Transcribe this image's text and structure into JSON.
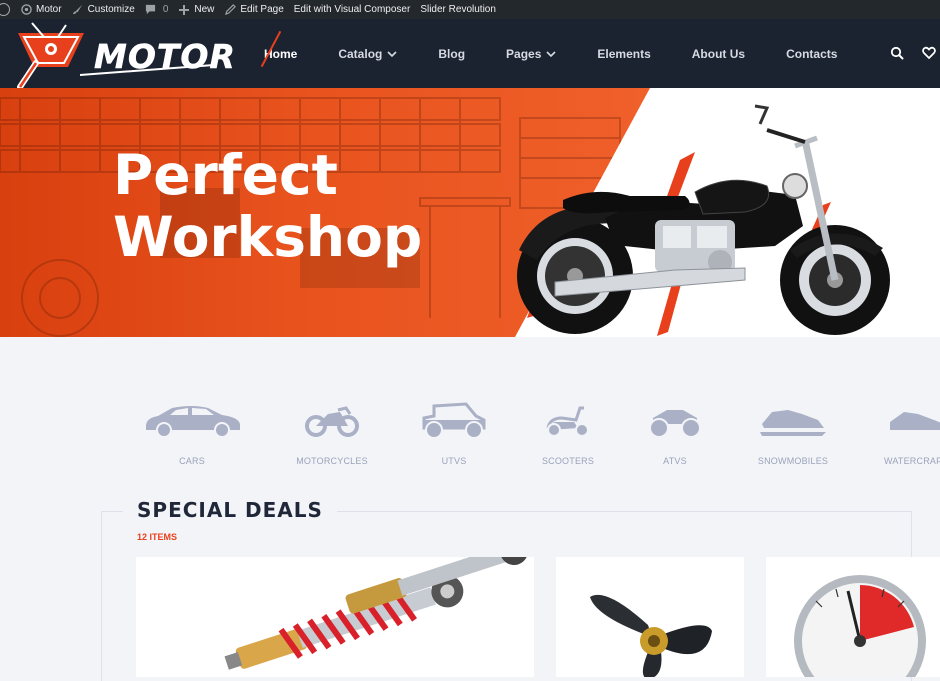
{
  "adminbar": {
    "items": [
      {
        "icon": "wordpress-icon",
        "label": ""
      },
      {
        "icon": "home-icon",
        "label": "Motor"
      },
      {
        "icon": "brush-icon",
        "label": "Customize"
      },
      {
        "icon": "comment-icon",
        "label": "",
        "count": "0"
      },
      {
        "icon": "plus-icon",
        "label": "New"
      },
      {
        "icon": "pencil-icon",
        "label": "Edit Page"
      },
      {
        "icon": "",
        "label": "Edit with Visual Composer"
      },
      {
        "icon": "",
        "label": "Slider Revolution"
      }
    ]
  },
  "header": {
    "logo_text": "MOTOR",
    "nav": [
      {
        "label": "Home",
        "active": true,
        "dropdown": false
      },
      {
        "label": "Catalog",
        "active": false,
        "dropdown": true
      },
      {
        "label": "Blog",
        "active": false,
        "dropdown": false
      },
      {
        "label": "Pages",
        "active": false,
        "dropdown": true
      },
      {
        "label": "Elements",
        "active": false,
        "dropdown": false
      },
      {
        "label": "About Us",
        "active": false,
        "dropdown": false
      },
      {
        "label": "Contacts",
        "active": false,
        "dropdown": false
      }
    ],
    "icons": [
      "search-icon",
      "heart-icon"
    ]
  },
  "hero": {
    "line1": "Perfect",
    "line2": "Workshop"
  },
  "categories": [
    {
      "label": "CARS",
      "icon": "car-icon"
    },
    {
      "label": "MOTORCYCLES",
      "icon": "motorcycle-icon"
    },
    {
      "label": "UTVS",
      "icon": "utv-icon"
    },
    {
      "label": "SCOOTERS",
      "icon": "scooter-icon"
    },
    {
      "label": "ATVS",
      "icon": "atv-icon"
    },
    {
      "label": "SNOWMOBILES",
      "icon": "snowmobile-icon"
    },
    {
      "label": "WATERCRAFT",
      "icon": "watercraft-icon"
    }
  ],
  "deals": {
    "title": "SPECIAL DEALS",
    "count": "12 ITEMS"
  },
  "colors": {
    "accent": "#e8401c",
    "header_bg": "#1b2330",
    "page_bg": "#f3f4f8",
    "category_grey": "#9aa3bb"
  }
}
